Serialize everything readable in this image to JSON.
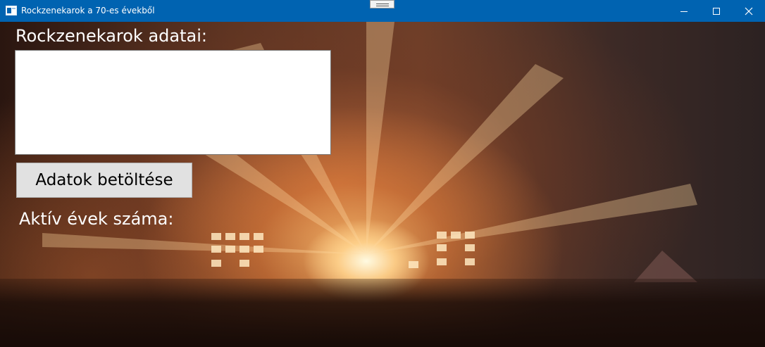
{
  "window": {
    "title": "Rockzenekarok a 70-es évekből",
    "app_icon": "window-app-icon",
    "controls": [
      "minimize-icon",
      "maximize-icon",
      "close-icon"
    ]
  },
  "form": {
    "header_label": "Rockzenekarok adatai:",
    "data_text": "",
    "load_button_label": "Adatok betöltése",
    "active_years_label": "Aktív évek száma:"
  },
  "colors": {
    "titlebar": "#0063b1",
    "label_text": "#ffffff",
    "button_bg": "#e1e1e1"
  }
}
